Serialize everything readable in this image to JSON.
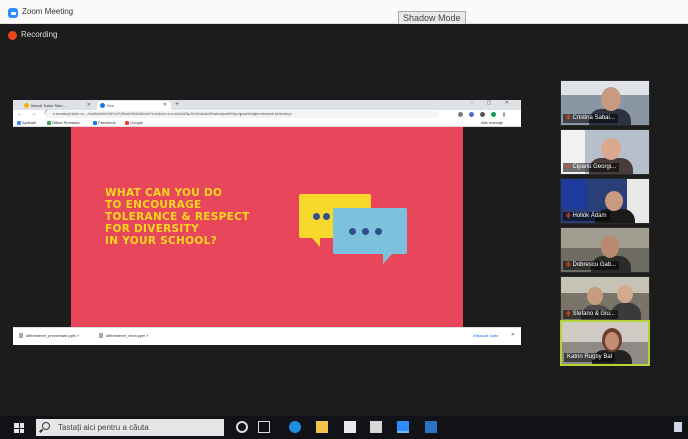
{
  "window": {
    "title": "Zoom Meeting",
    "shadow_mode": "Shadow Mode"
  },
  "meeting": {
    "recording_label": "Recording"
  },
  "shared_screen": {
    "tabs": [
      {
        "label": "Ileană Tudor Stan...",
        "color": "#f4b400"
      },
      {
        "label": "Xxx",
        "color": "#1a73e8"
      }
    ],
    "new_tab": "+",
    "window_controls": "– ▢ ✕",
    "nav_icons": "← → C",
    "url": "a  amusicipi.slide.ro/..../s/a/6kd/Hmt%/E/o/%28vd&Hf/d1&fhuikr?l=en&ver=t=e=s&Asli/3q/1t/v/fm&/alu/Moskvelpnelit/i/lpr/qpsaidchatjerr/dmasid/-ke/lerdisyn",
    "bookmarks": [
      {
        "label": "Aplicații",
        "color": "#4285f4"
      },
      {
        "label": "Office Romania",
        "color": "#34a853"
      },
      {
        "label": "Facebook",
        "color": "#1877f2"
      },
      {
        "label": "Google",
        "color": "#ea4335"
      }
    ],
    "reading_list": "Alte marcaje",
    "slide": {
      "question_lines": [
        "WHAT CAN YOU DO",
        "TO ENCOURAGE",
        "TOLERANCE & RESPECT",
        "FOR DIVERSITY",
        "IN YOUR SCHOOL?"
      ],
      "background": "#e8475b",
      "text_color": "#f7d81f",
      "bubble_yellow": "#f6d92c",
      "bubble_blue": "#7dc2dd"
    },
    "downloads": [
      {
        "label": "diferentiere_prezentare.pptx"
      },
      {
        "label": "diferentiere_elevi.pptx"
      }
    ],
    "show_all": "Afișează toate",
    "close": "✕"
  },
  "participants": [
    {
      "name": "Cristina Sabai...",
      "muted": true,
      "active": false
    },
    {
      "name": "Cipariu Georgi...",
      "muted": true,
      "active": false
    },
    {
      "name": "Hollók Ádám",
      "muted": true,
      "active": false
    },
    {
      "name": "Dobrescu Gab...",
      "muted": true,
      "active": false
    },
    {
      "name": "Stefano & Giu...",
      "muted": true,
      "active": false
    },
    {
      "name": "Katrin Rugby Bal",
      "muted": false,
      "active": true
    }
  ],
  "taskbar": {
    "search_placeholder": "Tastați aici pentru a căuta",
    "icons": [
      "cortana-icon",
      "task-view-icon",
      "edge-icon",
      "file-explorer-icon",
      "store-icon",
      "mail-icon",
      "zoom-icon",
      "outlook-icon"
    ]
  }
}
